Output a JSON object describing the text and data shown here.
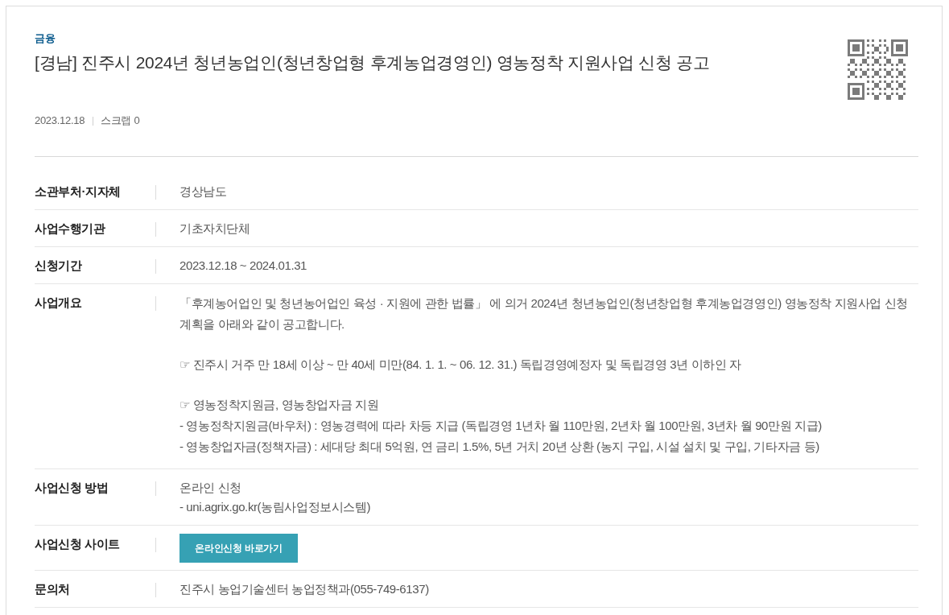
{
  "category": "금융",
  "title": "[경남] 진주시 2024년 청년농업인(청년창업형 후계농업경영인) 영농정착 지원사업 신청 공고",
  "meta": {
    "date": "2023.12.18",
    "scrap": "스크랩 0"
  },
  "details": [
    {
      "label": "소관부처·지자체",
      "kind": "text",
      "lines": [
        "경상남도"
      ]
    },
    {
      "label": "사업수행기관",
      "kind": "text",
      "lines": [
        "기초자치단체"
      ]
    },
    {
      "label": "신청기간",
      "kind": "text",
      "lines": [
        "2023.12.18 ~ 2024.01.31"
      ]
    },
    {
      "label": "사업개요",
      "kind": "paragraphs",
      "paragraphs": [
        [
          "「후계농어업인 및 청년농어업인 육성 · 지원에 관한 법률」 에 의거 2024년 청년농업인(청년창업형 후계농업경영인) 영농정착 지원사업 신청 계획을 아래와 같이 공고합니다."
        ],
        [
          "☞ 진주시 거주 만 18세 이상 ~ 만 40세 미만(84. 1. 1. ~ 06. 12. 31.) 독립경영예정자 및 독립경영 3년 이하인 자"
        ],
        [
          "☞ 영농정착지원금, 영농창업자금 지원",
          "- 영농정착지원금(바우처) : 영농경력에 따라 차등 지급 (독립경영 1년차 월 110만원, 2년차 월 100만원, 3년차 월 90만원 지급)",
          "- 영농창업자금(정책자금) : 세대당 최대 5억원, 연 금리 1.5%, 5년 거치 20년 상환 (농지 구입, 시설 설치 및 구입, 기타자금 등)"
        ]
      ]
    },
    {
      "label": "사업신청 방법",
      "kind": "text",
      "lines": [
        "온라인 신청",
        "- uni.agrix.go.kr(농림사업정보시스템)"
      ]
    },
    {
      "label": "사업신청 사이트",
      "kind": "button",
      "button": "온라인신청 바로가기"
    },
    {
      "label": "문의처",
      "kind": "text",
      "lines": [
        "진주시 농업기술센터 농업정책과(055-749-6137)"
      ]
    }
  ]
}
